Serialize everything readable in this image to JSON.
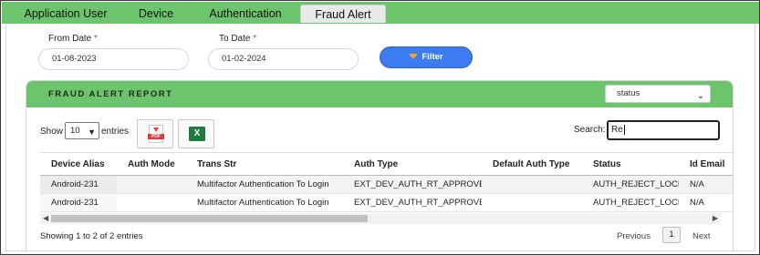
{
  "tabs": [
    {
      "label": "Application User",
      "active": false
    },
    {
      "label": "Device",
      "active": false
    },
    {
      "label": "Authentication",
      "active": false
    },
    {
      "label": "Fraud Alert",
      "active": true
    }
  ],
  "filters": {
    "from_label": "From Date",
    "to_label": "To Date",
    "required_mark": "*",
    "from_value": "01-08-2023",
    "to_value": "01-02-2024",
    "filter_label": "Filter"
  },
  "report": {
    "title": "FRAUD ALERT REPORT",
    "status_value": "status"
  },
  "table_controls": {
    "show_label": "Show",
    "entries_value": "10",
    "entries_label": "entries",
    "search_label": "Search:",
    "search_value": "Re"
  },
  "table": {
    "headers": [
      "Device Alias",
      "Auth Mode",
      "Trans Str",
      "Auth Type",
      "Default Auth Type",
      "Status",
      "Id Email"
    ],
    "rows": [
      [
        "Android-231",
        "",
        "Multifactor Authentication To Login",
        "EXT_DEV_AUTH_RT_APPROVE",
        "",
        "AUTH_REJECT_LOCK",
        "N/A"
      ],
      [
        "Android-231",
        "",
        "Multifactor Authentication To Login",
        "EXT_DEV_AUTH_RT_APPROVE",
        "",
        "AUTH_REJECT_LOCK",
        "N/A"
      ]
    ]
  },
  "footer": {
    "info": "Showing 1 to 2 of 2 entries",
    "previous": "Previous",
    "page": "1",
    "next": "Next"
  },
  "colors": {
    "accent_green": "#6cc46c",
    "filter_blue": "#3d7bf0",
    "required_red": "#e53935"
  }
}
